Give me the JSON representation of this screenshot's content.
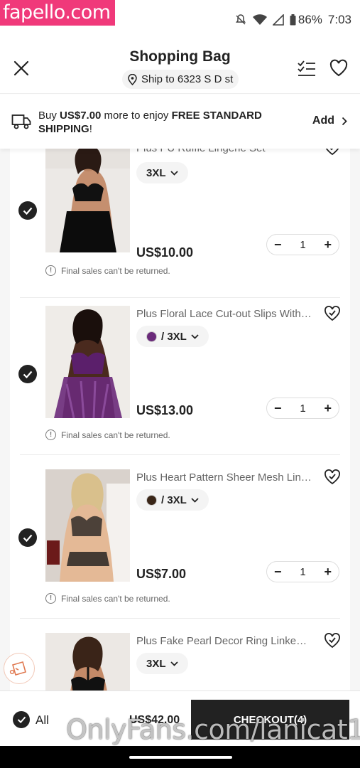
{
  "watermark_top": "fapello.com",
  "watermark_bottom": "OnlyFans.com/lanicat1",
  "status": {
    "battery": "86%",
    "time": "7:03"
  },
  "header": {
    "title": "Shopping Bag",
    "ship_to": "Ship to 6323 S D st"
  },
  "promo": {
    "prefix": "Buy ",
    "amount": "US$7.00",
    "middle": " more to enjoy ",
    "highlight": "FREE STANDARD SHIPPING",
    "suffix": "!",
    "action": "Add"
  },
  "items": [
    {
      "title": "Plus PU Ruffle Lingerie Set",
      "variant": "3XL",
      "swatch": "",
      "price": "US$10.00",
      "qty": "1",
      "note": "Final sales can't be returned."
    },
    {
      "title": "Plus Floral Lace Cut-out Slips With ...",
      "variant": "/ 3XL",
      "swatch": "#6a2a7a",
      "price": "US$13.00",
      "qty": "1",
      "note": "Final sales can't be returned."
    },
    {
      "title": "Plus Heart Pattern Sheer Mesh Ling...",
      "variant": "/ 3XL",
      "swatch": "#3a2618",
      "price": "US$7.00",
      "qty": "1",
      "note": "Final sales can't be returned."
    },
    {
      "title": "Plus Fake Pearl Decor Ring Linked ...",
      "variant": "3XL",
      "swatch": "",
      "price": "",
      "qty": "",
      "note": ""
    }
  ],
  "footer": {
    "all_label": "All",
    "total": "US$42.00",
    "checkout": "CHECKOUT(4)"
  },
  "colors": {
    "brand_pink": "#f0397a",
    "dark": "#222222",
    "swatch_purple": "#6a2a7a",
    "swatch_brown": "#3a2618"
  }
}
